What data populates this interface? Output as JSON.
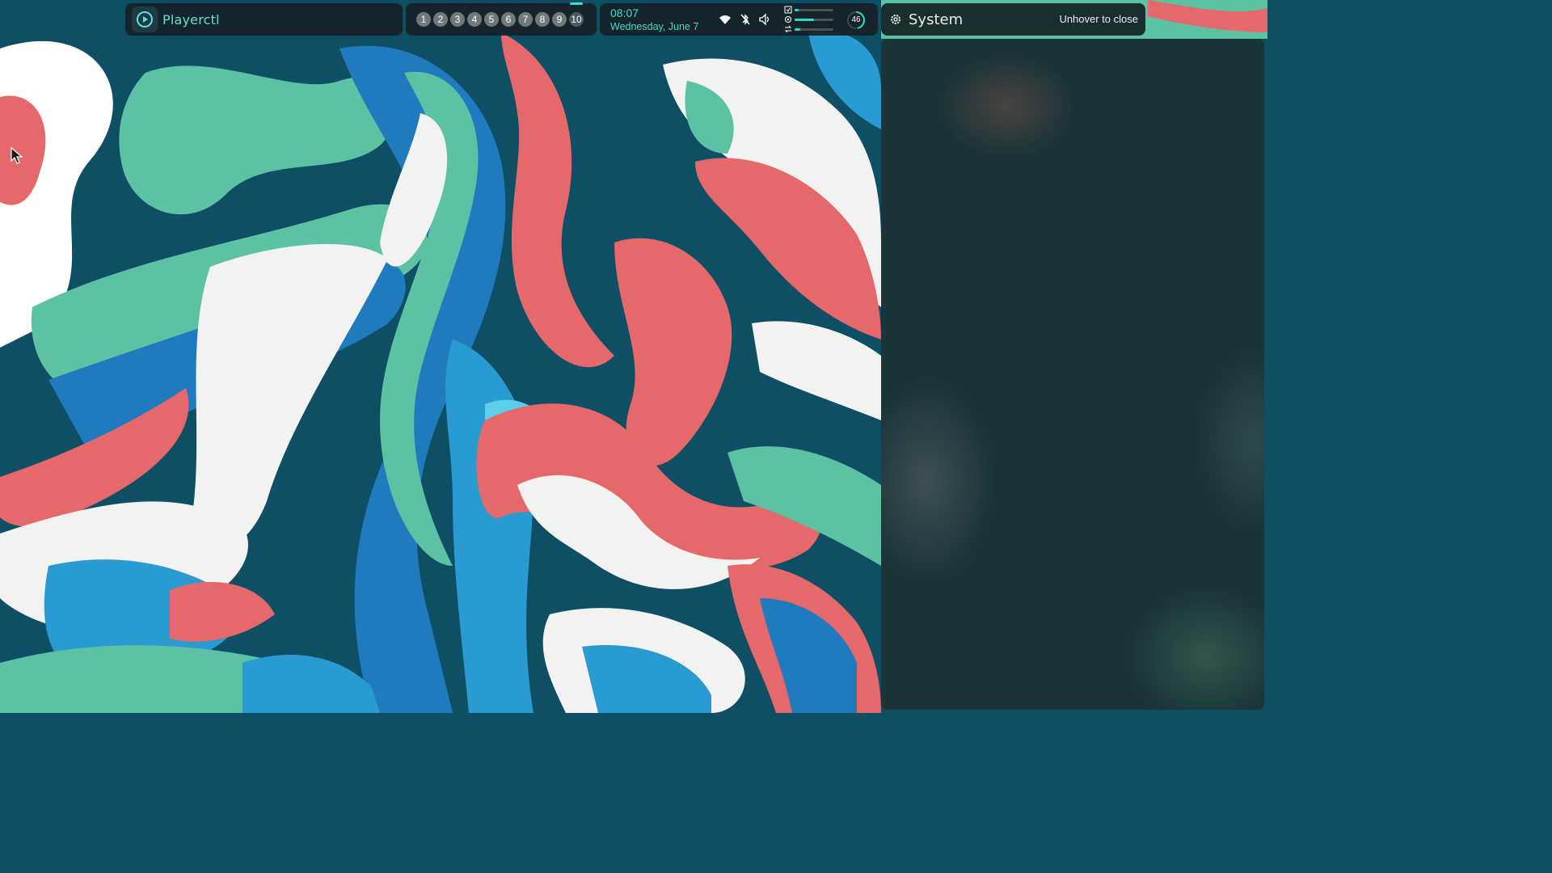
{
  "colors": {
    "accent": "#2fd8cc",
    "bar_bg": "#162126",
    "panel_bg": "#1b3439"
  },
  "media": {
    "icon": "play-circle-icon",
    "label": "Playerctl"
  },
  "workspaces": {
    "items": [
      "1",
      "2",
      "3",
      "4",
      "5",
      "6",
      "7",
      "8",
      "9",
      "10"
    ],
    "active": "10"
  },
  "clock": {
    "time": "08:07",
    "date": "Wednesday, June 7"
  },
  "status": {
    "icons": [
      "wifi-icon",
      "bluetooth-off-icon",
      "volume-icon"
    ],
    "meters": [
      {
        "icon": "clipboard-icon",
        "level": 0.1
      },
      {
        "icon": "cpu-icon",
        "level": 0.5
      },
      {
        "icon": "swap-icon",
        "level": 0.15
      }
    ],
    "battery": {
      "value": "46",
      "level": 0.46
    }
  },
  "system": {
    "icon": "gear-icon",
    "title": "System",
    "hint": "Unhover to close"
  }
}
